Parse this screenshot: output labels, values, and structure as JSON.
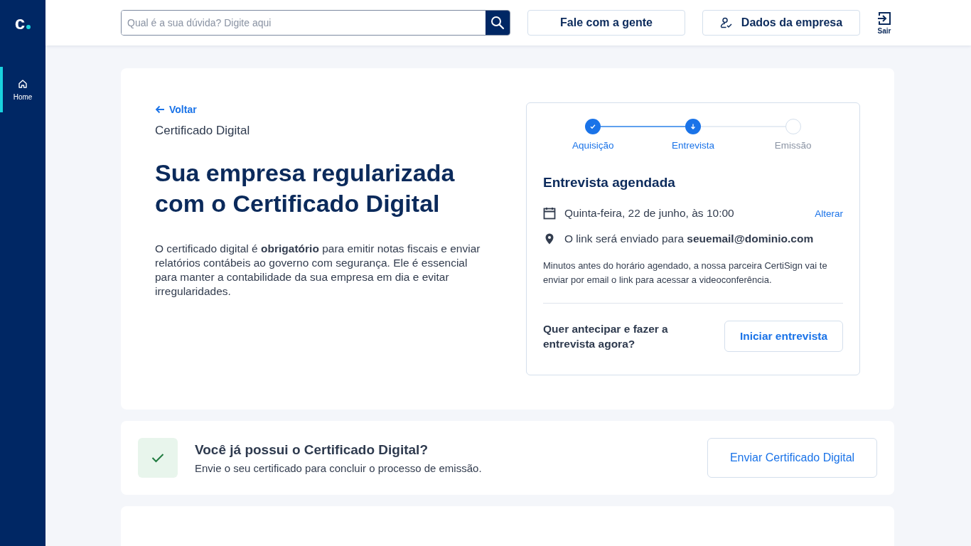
{
  "sidebar": {
    "logo": "c",
    "items": [
      {
        "label": "Home",
        "selected": true
      }
    ]
  },
  "topbar": {
    "search": {
      "placeholder": "Qual é a sua dúvida? Digite aqui"
    },
    "buttons": [
      {
        "label": "Fale com a gente",
        "kind": "plain"
      },
      {
        "label": "Dados da empresa",
        "kind": "user"
      }
    ],
    "logout": "Sair"
  },
  "main_card": {
    "back": "Voltar",
    "eyebrow": "Certificado Digital",
    "title": "Sua empresa regularizada com o Certificado Digital",
    "description": "O certificado digital é **obrigatório** para emitir notas fiscais e enviar relatórios contábeis ao governo com segurança. Ele é essencial para manter a contabilidade da sua empresa em dia e evitar irregularidades.",
    "steps": [
      {
        "label": "Aquisição",
        "kind": "completed"
      },
      {
        "label": "Entrevista",
        "kind": "current"
      },
      {
        "label": "Emissão",
        "kind": "pending"
      }
    ],
    "panel_title": "Entrevista agendada",
    "details": [
      {
        "kind": "date",
        "text": "Quinta-feira, 22 de junho, às 10:00",
        "action": "Alterar"
      },
      {
        "kind": "location",
        "text": "O link será enviado para **seuemail@dominio.com**"
      }
    ],
    "note": "Minutos antes do horário agendado, a nossa parceira CertiSign vai te enviar por email o link para acessar a videoconferência.",
    "prompt": "Quer antecipar e fazer a entrevista agora?",
    "cta": "Iniciar entrevista"
  },
  "upload_card": {
    "title": "Você já possui o Certificado Digital?",
    "subtitle": "Envie o seu certificado para concluir o processo de emissão.",
    "button": "Enviar Certificado Digital"
  }
}
